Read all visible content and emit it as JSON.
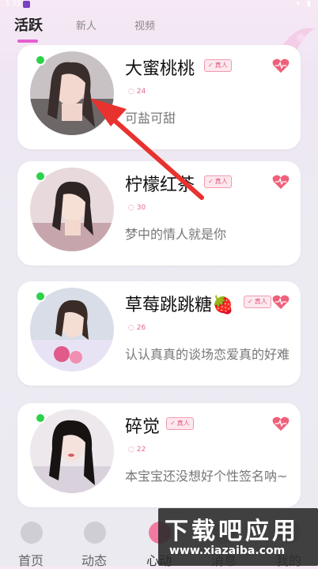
{
  "status_bar": {
    "time": "3:33"
  },
  "tabs": [
    {
      "label": "活跃",
      "active": true
    },
    {
      "label": "新人",
      "active": false
    },
    {
      "label": "视频",
      "active": false
    }
  ],
  "badge_label": "真人",
  "cards": [
    {
      "name": "大蜜桃桃",
      "count": "24",
      "bio": "可盐可甜",
      "online": true
    },
    {
      "name": "柠檬红茶",
      "count": "30",
      "bio": "梦中的情人就是你",
      "online": true
    },
    {
      "name": "草莓跳跳糖🍓",
      "count": "26",
      "bio": "认认真真的谈场恋爱真的好难",
      "online": true
    },
    {
      "name": "碎觉",
      "count": "22",
      "bio": "本宝宝还没想好个性签名呐~",
      "online": true
    }
  ],
  "bottom_nav": [
    {
      "label": "首页",
      "icon": "bird-icon"
    },
    {
      "label": "动态",
      "icon": "compass-icon"
    },
    {
      "label": "心动",
      "icon": "heart-icon"
    },
    {
      "label": "消息",
      "icon": "message-icon"
    },
    {
      "label": "我的",
      "icon": "user-icon"
    }
  ],
  "watermark": {
    "title": "下载吧应用",
    "url": "www.xiazaiba.com"
  },
  "colors": {
    "accent": "#e55fd0",
    "online": "#2bd24a",
    "heart": "#f0607a",
    "badge": "#e05a7c"
  }
}
